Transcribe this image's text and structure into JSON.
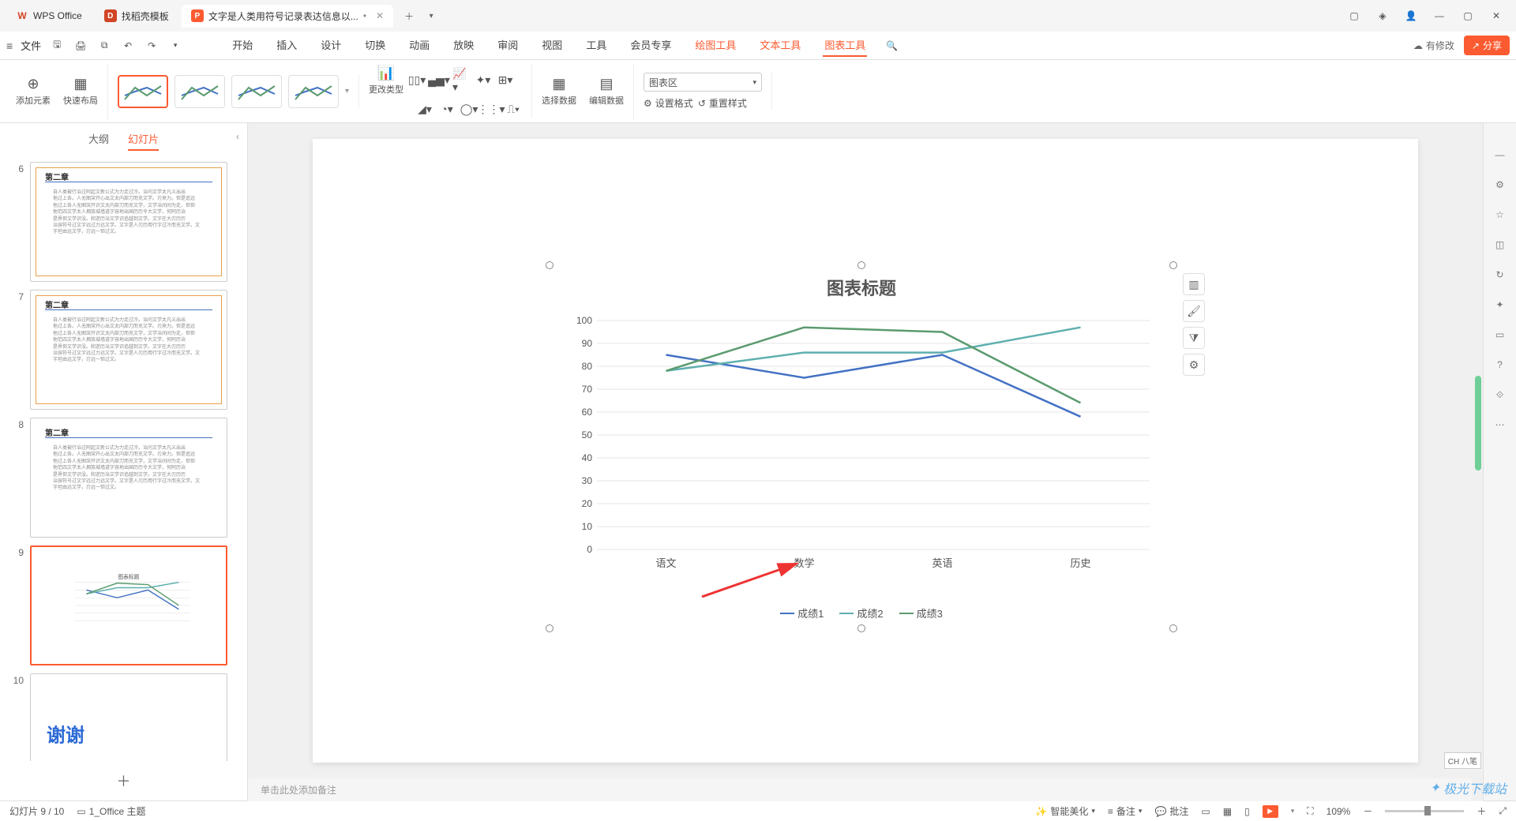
{
  "tabs": {
    "wps": "WPS Office",
    "template": "找稻壳模板",
    "doc": "文字是人类用符号记录表达信息以..."
  },
  "menubar": {
    "file": "文件",
    "items": [
      "开始",
      "插入",
      "设计",
      "切换",
      "动画",
      "放映",
      "审阅",
      "视图",
      "工具",
      "会员专享",
      "绘图工具",
      "文本工具",
      "图表工具"
    ],
    "pending": "有修改",
    "share": "分享"
  },
  "ribbon": {
    "add_element": "添加元素",
    "quick_layout": "快速布局",
    "change_type": "更改类型",
    "select_data": "选择数据",
    "edit_data": "编辑数据",
    "combo_value": "图表区",
    "set_format": "设置格式",
    "reset_style": "重置样式"
  },
  "panel": {
    "outline": "大纲",
    "slides": "幻灯片",
    "thumbs": [
      {
        "n": "6",
        "title": "第二章"
      },
      {
        "n": "7",
        "title": "第二章"
      },
      {
        "n": "8",
        "title": "第二章"
      },
      {
        "n": "9",
        "title": ""
      },
      {
        "n": "10",
        "title": ""
      }
    ],
    "thanks": "谢谢"
  },
  "chart_data": {
    "type": "line",
    "title": "图表标题",
    "categories": [
      "语文",
      "数学",
      "英语",
      "历史"
    ],
    "series": [
      {
        "name": "成绩1",
        "values": [
          85,
          75,
          85,
          58
        ],
        "color": "#4472c4"
      },
      {
        "name": "成绩2",
        "values": [
          78,
          86,
          86,
          97
        ],
        "color": "#5fafaf"
      },
      {
        "name": "成绩3",
        "values": [
          78,
          97,
          95,
          64
        ],
        "color": "#5b9b6f"
      }
    ],
    "y_ticks": [
      0,
      10,
      20,
      30,
      40,
      50,
      60,
      70,
      80,
      90,
      100
    ],
    "ylim": [
      0,
      100
    ]
  },
  "notes": "单击此处添加备注",
  "status": {
    "slide_pos": "幻灯片 9 / 10",
    "theme": "1_Office 主题",
    "beautify": "智能美化",
    "notes_toggle": "备注",
    "comments": "批注",
    "zoom": "109%",
    "ime": "CH 八笔"
  },
  "watermark": "极光下载站"
}
